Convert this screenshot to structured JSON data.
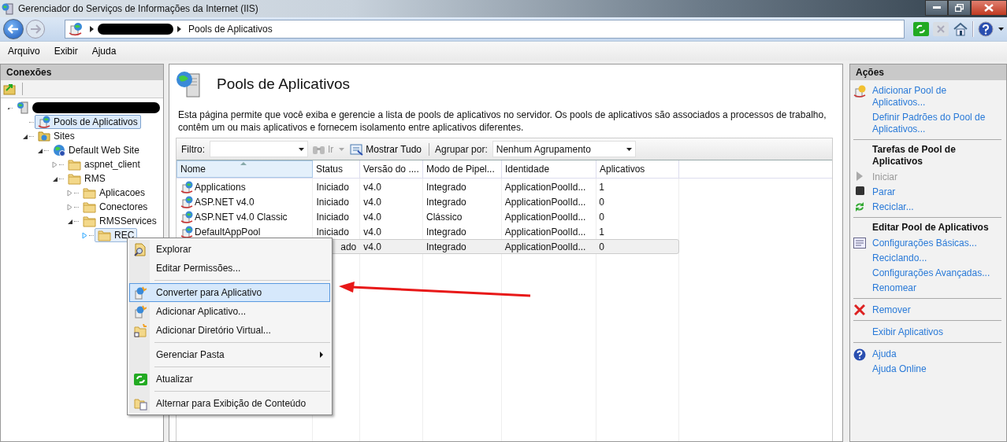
{
  "window": {
    "title": "Gerenciador do Serviços de Informações da Internet (IIS)"
  },
  "address": {
    "crumbs": [
      {
        "kind": "redacted"
      },
      {
        "kind": "text",
        "label": "Pools de Aplicativos"
      }
    ]
  },
  "nav_tools": [
    {
      "kind": "refresh",
      "disabled": false
    },
    {
      "kind": "stop",
      "disabled": true
    },
    {
      "kind": "home",
      "disabled": false
    },
    {
      "kind": "help",
      "disabled": false
    }
  ],
  "menu": [
    "Arquivo",
    "Exibir",
    "Ajuda"
  ],
  "connections": {
    "title": "Conexões",
    "tree": [
      {
        "kind": "server",
        "redacted": true,
        "expanded": true,
        "selected": false,
        "children": [
          {
            "kind": "pool",
            "label": "Pools de Aplicativos",
            "selected": true
          },
          {
            "kind": "sites",
            "label": "Sites",
            "expanded": true,
            "selected": false,
            "children": [
              {
                "kind": "globe",
                "label": "Default Web Site",
                "expanded": true,
                "selected": false,
                "children": [
                  {
                    "kind": "folder",
                    "label": "aspnet_client",
                    "expanded": false,
                    "selected": false
                  },
                  {
                    "kind": "folder",
                    "label": "RMS",
                    "expanded": true,
                    "selected": false,
                    "children": [
                      {
                        "kind": "folder",
                        "label": "Aplicacoes",
                        "expanded": false,
                        "selected": false
                      },
                      {
                        "kind": "folder",
                        "label": "Conectores",
                        "expanded": false,
                        "selected": false
                      },
                      {
                        "kind": "folder",
                        "label": "RMSServices",
                        "expanded": true,
                        "selected": false,
                        "children": [
                          {
                            "kind": "folder",
                            "label": "REC",
                            "expanded": false,
                            "selected": false,
                            "focused": true
                          }
                        ]
                      }
                    ]
                  }
                ]
              }
            ]
          }
        ]
      }
    ]
  },
  "page": {
    "title": "Pools de Aplicativos",
    "description": "Esta página permite que você exiba e gerencie a lista de pools de aplicativos no servidor. Os pools de aplicativos são associados a processos de trabalho, contêm um ou mais aplicativos e fornecem isolamento entre aplicativos diferentes.",
    "filter": {
      "label": "Filtro:",
      "go": "Ir",
      "show_all": "Mostrar Tudo",
      "group_label": "Agrupar por:",
      "group_value": "Nenhum Agrupamento"
    },
    "table": {
      "columns": [
        {
          "label": "Nome",
          "sorted": true
        },
        {
          "label": "Status",
          "sorted": false
        },
        {
          "label": "Versão do ....",
          "sorted": false
        },
        {
          "label": "Modo de Pipel...",
          "sorted": false
        },
        {
          "label": "Identidade",
          "sorted": false
        },
        {
          "label": "Aplicativos",
          "sorted": false
        }
      ],
      "rows": [
        {
          "kind": "full",
          "selected": false,
          "cells": [
            "Applications",
            "Iniciado",
            "v4.0",
            "Integrado",
            "ApplicationPoolId...",
            "1"
          ]
        },
        {
          "kind": "full",
          "selected": false,
          "cells": [
            "ASP.NET v4.0",
            "Iniciado",
            "v4.0",
            "Integrado",
            "ApplicationPoolId...",
            "0"
          ]
        },
        {
          "kind": "full",
          "selected": false,
          "cells": [
            "ASP.NET v4.0 Classic",
            "Iniciado",
            "v4.0",
            "Clássico",
            "ApplicationPoolId...",
            "0"
          ]
        },
        {
          "kind": "full",
          "selected": false,
          "cells": [
            "DefaultAppPool",
            "Iniciado",
            "v4.0",
            "Integrado",
            "ApplicationPoolId...",
            "1"
          ]
        },
        {
          "kind": "covered",
          "selected": true,
          "cells": [
            null,
            "ado",
            "v4.0",
            "Integrado",
            "ApplicationPoolId...",
            "0"
          ]
        }
      ]
    }
  },
  "context_menu": [
    {
      "kind": "item",
      "label": "Explorar",
      "selected": false
    },
    {
      "kind": "item",
      "label": "Editar Permissões...",
      "selected": false
    },
    {
      "kind": "separator"
    },
    {
      "kind": "item",
      "label": "Converter para Aplicativo",
      "selected": true
    },
    {
      "kind": "item",
      "label": "Adicionar Aplicativo...",
      "selected": false
    },
    {
      "kind": "item",
      "label": "Adicionar Diretório Virtual...",
      "selected": false
    },
    {
      "kind": "separator"
    },
    {
      "kind": "submenu",
      "label": "Gerenciar Pasta",
      "selected": false
    },
    {
      "kind": "separator"
    },
    {
      "kind": "item",
      "label": "Atualizar",
      "selected": false
    },
    {
      "kind": "separator"
    },
    {
      "kind": "item",
      "label": "Alternar para Exibição de Conteúdo",
      "selected": false
    }
  ],
  "actions": {
    "title": "Ações",
    "items": [
      {
        "kind": "link",
        "label": "Adicionar Pool de Aplicativos...",
        "disabled": false
      },
      {
        "kind": "link",
        "label": "Definir Padrões do Pool de Aplicativos...",
        "disabled": false
      },
      {
        "kind": "separator"
      },
      {
        "kind": "heading",
        "label": "Tarefas de Pool de Aplicativos"
      },
      {
        "kind": "link",
        "label": "Iniciar",
        "disabled": true
      },
      {
        "kind": "link",
        "label": "Parar",
        "disabled": false
      },
      {
        "kind": "link",
        "label": "Reciclar...",
        "disabled": false
      },
      {
        "kind": "separator"
      },
      {
        "kind": "heading",
        "label": "Editar Pool de Aplicativos"
      },
      {
        "kind": "link",
        "label": "Configurações Básicas...",
        "disabled": false
      },
      {
        "kind": "link",
        "label": "Reciclando...",
        "disabled": false
      },
      {
        "kind": "link",
        "label": "Configurações Avançadas...",
        "disabled": false
      },
      {
        "kind": "link",
        "label": "Renomear",
        "disabled": false
      },
      {
        "kind": "separator"
      },
      {
        "kind": "link",
        "label": "Remover",
        "disabled": false
      },
      {
        "kind": "separator"
      },
      {
        "kind": "link",
        "label": "Exibir Aplicativos",
        "disabled": false
      },
      {
        "kind": "separator"
      },
      {
        "kind": "link",
        "label": "Ajuda",
        "disabled": false
      },
      {
        "kind": "link",
        "label": "Ajuda Online",
        "disabled": false
      }
    ]
  }
}
